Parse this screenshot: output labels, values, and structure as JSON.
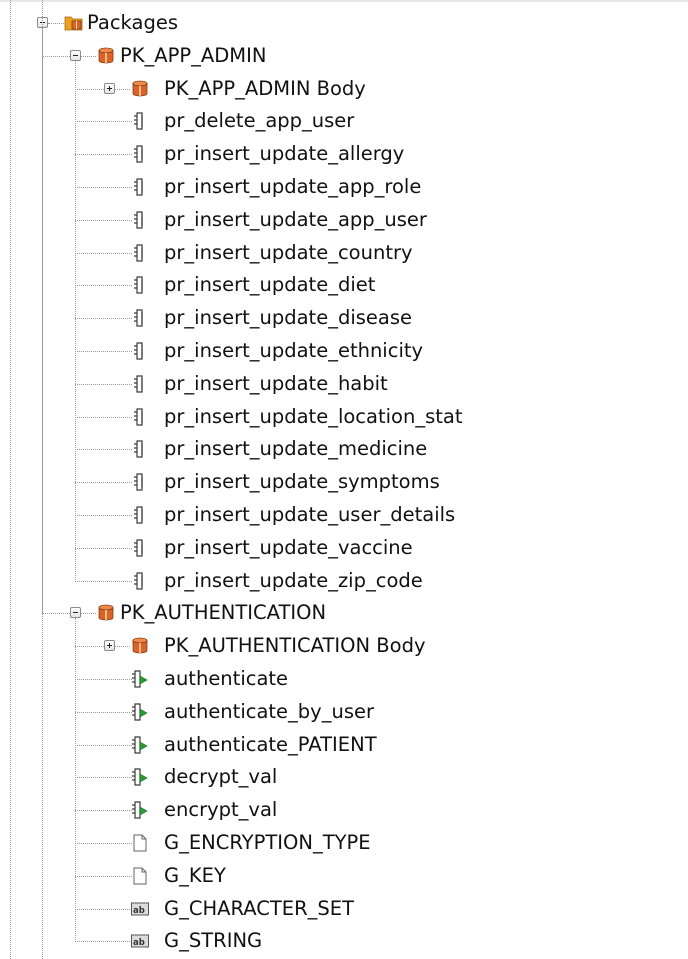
{
  "tree": {
    "packages": {
      "label": "Packages",
      "icon": "folder-package-icon",
      "expanded": true,
      "children": [
        {
          "label": "PK_APP_ADMIN",
          "icon": "package-icon",
          "expanded": true,
          "children": [
            {
              "label": "PK_APP_ADMIN Body",
              "icon": "package-icon",
              "expanded": false
            },
            {
              "label": "pr_delete_app_user",
              "icon": "procedure-icon"
            },
            {
              "label": "pr_insert_update_allergy",
              "icon": "procedure-icon"
            },
            {
              "label": "pr_insert_update_app_role",
              "icon": "procedure-icon"
            },
            {
              "label": "pr_insert_update_app_user",
              "icon": "procedure-icon"
            },
            {
              "label": "pr_insert_update_country",
              "icon": "procedure-icon"
            },
            {
              "label": "pr_insert_update_diet",
              "icon": "procedure-icon"
            },
            {
              "label": "pr_insert_update_disease",
              "icon": "procedure-icon"
            },
            {
              "label": "pr_insert_update_ethnicity",
              "icon": "procedure-icon"
            },
            {
              "label": "pr_insert_update_habit",
              "icon": "procedure-icon"
            },
            {
              "label": "pr_insert_update_location_stat",
              "icon": "procedure-icon"
            },
            {
              "label": "pr_insert_update_medicine",
              "icon": "procedure-icon"
            },
            {
              "label": "pr_insert_update_symptoms",
              "icon": "procedure-icon"
            },
            {
              "label": "pr_insert_update_user_details",
              "icon": "procedure-icon"
            },
            {
              "label": "pr_insert_update_vaccine",
              "icon": "procedure-icon"
            },
            {
              "label": "pr_insert_update_zip_code",
              "icon": "procedure-icon"
            }
          ]
        },
        {
          "label": "PK_AUTHENTICATION",
          "icon": "package-icon",
          "expanded": true,
          "children": [
            {
              "label": "PK_AUTHENTICATION Body",
              "icon": "package-icon",
              "expanded": false
            },
            {
              "label": "authenticate",
              "icon": "function-icon"
            },
            {
              "label": "authenticate_by_user",
              "icon": "function-icon"
            },
            {
              "label": "authenticate_PATIENT",
              "icon": "function-icon"
            },
            {
              "label": "decrypt_val",
              "icon": "function-icon"
            },
            {
              "label": "encrypt_val",
              "icon": "function-icon"
            },
            {
              "label": "G_ENCRYPTION_TYPE",
              "icon": "constant-icon"
            },
            {
              "label": "G_KEY",
              "icon": "constant-icon"
            },
            {
              "label": "G_CHARACTER_SET",
              "icon": "variable-icon"
            },
            {
              "label": "G_STRING",
              "icon": "variable-icon"
            }
          ]
        }
      ]
    }
  },
  "colors": {
    "folder": "#e9a221",
    "package": "#d8642a",
    "procedure": "#3a3a3a",
    "function_arrow": "#2a9a3a",
    "tree_lines": "#9a9a9a"
  }
}
